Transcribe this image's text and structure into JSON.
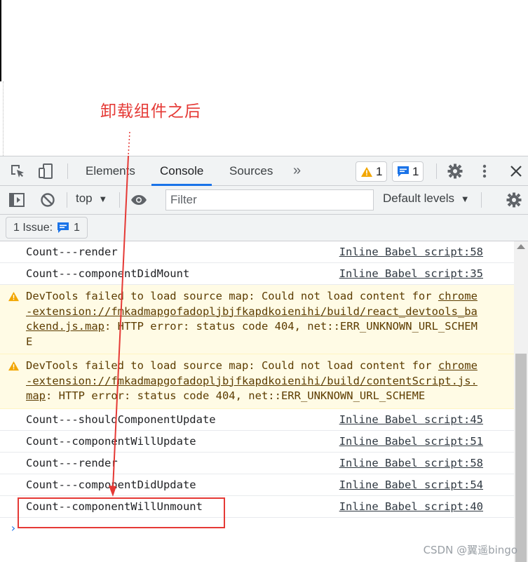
{
  "annotation": {
    "text": "卸载组件之后",
    "color": "#e53935"
  },
  "tabs": [
    {
      "label": "Elements"
    },
    {
      "label": "Console"
    },
    {
      "label": "Sources"
    }
  ],
  "more_tabs_label": "»",
  "badges": {
    "warnings_count": "1",
    "messages_count": "1"
  },
  "toolbar": {
    "context": "top",
    "filter_placeholder": "Filter",
    "levels": "Default levels"
  },
  "issues_bar": {
    "label": "1 Issue:",
    "count": "1"
  },
  "console_rows": {
    "r0": {
      "msg": "Count---render",
      "src": "Inline Babel script:58"
    },
    "r1": {
      "msg": "Count---componentDidMount",
      "src": "Inline Babel script:35"
    },
    "w0": {
      "prefix": "DevTools failed to load source map: Could not load content for ",
      "link": "chrome-extension://fmkadmapgofadopljbjfkapdkoienihi/build/react_devtools_backend.js.map",
      "suffix": ": HTTP error: status code 404, net::ERR_UNKNOWN_URL_SCHEME"
    },
    "w1": {
      "prefix": "DevTools failed to load source map: Could not load content for ",
      "link": "chrome-extension://fmkadmapgofadopljbjfkapdkoienihi/build/contentScript.js.map",
      "suffix": ": HTTP error: status code 404, net::ERR_UNKNOWN_URL_SCHEME"
    },
    "r2": {
      "msg": "Count---shouldComponentUpdate",
      "src": "Inline Babel script:45"
    },
    "r3": {
      "msg": "Count--componentWillUpdate",
      "src": "Inline Babel script:51"
    },
    "r4": {
      "msg": "Count---render",
      "src": "Inline Babel script:58"
    },
    "r5": {
      "msg": "Count---componentDidUpdate",
      "src": "Inline Babel script:54"
    },
    "r6": {
      "msg": "Count--componentWillUnmount",
      "src": "Inline Babel script:40"
    }
  },
  "prompt_symbol": "›",
  "watermark": "CSDN @翼遥bingo",
  "colors": {
    "accent": "#1a73e8",
    "warning_bg": "#fffbe5",
    "annotation": "#e53935"
  }
}
